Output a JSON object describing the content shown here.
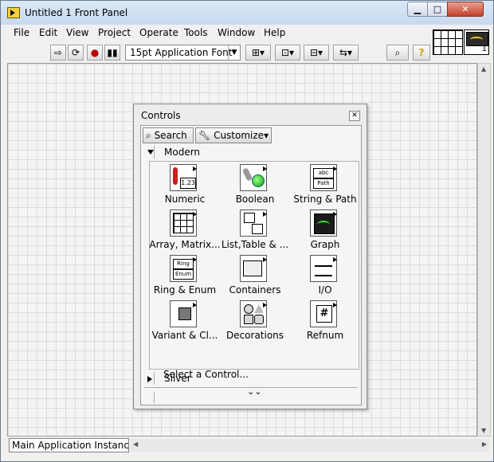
{
  "window": {
    "title": "Untitled 1 Front Panel",
    "controls": {
      "minimize": "▁",
      "maximize": "□",
      "close": "✕"
    }
  },
  "menu": [
    "File",
    "Edit",
    "View",
    "Project",
    "Operate",
    "Tools",
    "Window",
    "Help"
  ],
  "toolbar": {
    "font": "15pt Application Font",
    "font_arrow": "▼"
  },
  "connector_pane": {
    "vi_icon_number": "1"
  },
  "status": {
    "instance": "Main Application Instance"
  },
  "controls_palette": {
    "title": "Controls",
    "close_glyph": "✕",
    "search_label": "Search",
    "customize_label": "Customize",
    "customize_arrow": "▾",
    "sections": {
      "modern": "Modern",
      "silver": "Silver"
    },
    "items": [
      {
        "label": "Numeric",
        "icon": "numeric-icon"
      },
      {
        "label": "Boolean",
        "icon": "boolean-icon"
      },
      {
        "label": "String & Path",
        "icon": "string-path-icon"
      },
      {
        "label": "Array, Matrix...",
        "icon": "array-matrix-icon"
      },
      {
        "label": "List,Table & ...",
        "icon": "list-table-icon"
      },
      {
        "label": "Graph",
        "icon": "graph-icon"
      },
      {
        "label": "Ring & Enum",
        "icon": "ring-enum-icon"
      },
      {
        "label": "Containers",
        "icon": "containers-icon"
      },
      {
        "label": "I/O",
        "icon": "io-icon"
      },
      {
        "label": "Variant & Cl...",
        "icon": "variant-class-icon"
      },
      {
        "label": "Decorations",
        "icon": "decorations-icon"
      },
      {
        "label": "Refnum",
        "icon": "refnum-icon"
      }
    ],
    "icon_text": {
      "numeric_value": "1.23",
      "string_box": "abc",
      "path_box": "Path",
      "ring_box": "Ring",
      "enum_box": "Enum",
      "refnum": "#"
    },
    "footer": "Select a Control...",
    "more_glyph": "⌄⌄"
  }
}
